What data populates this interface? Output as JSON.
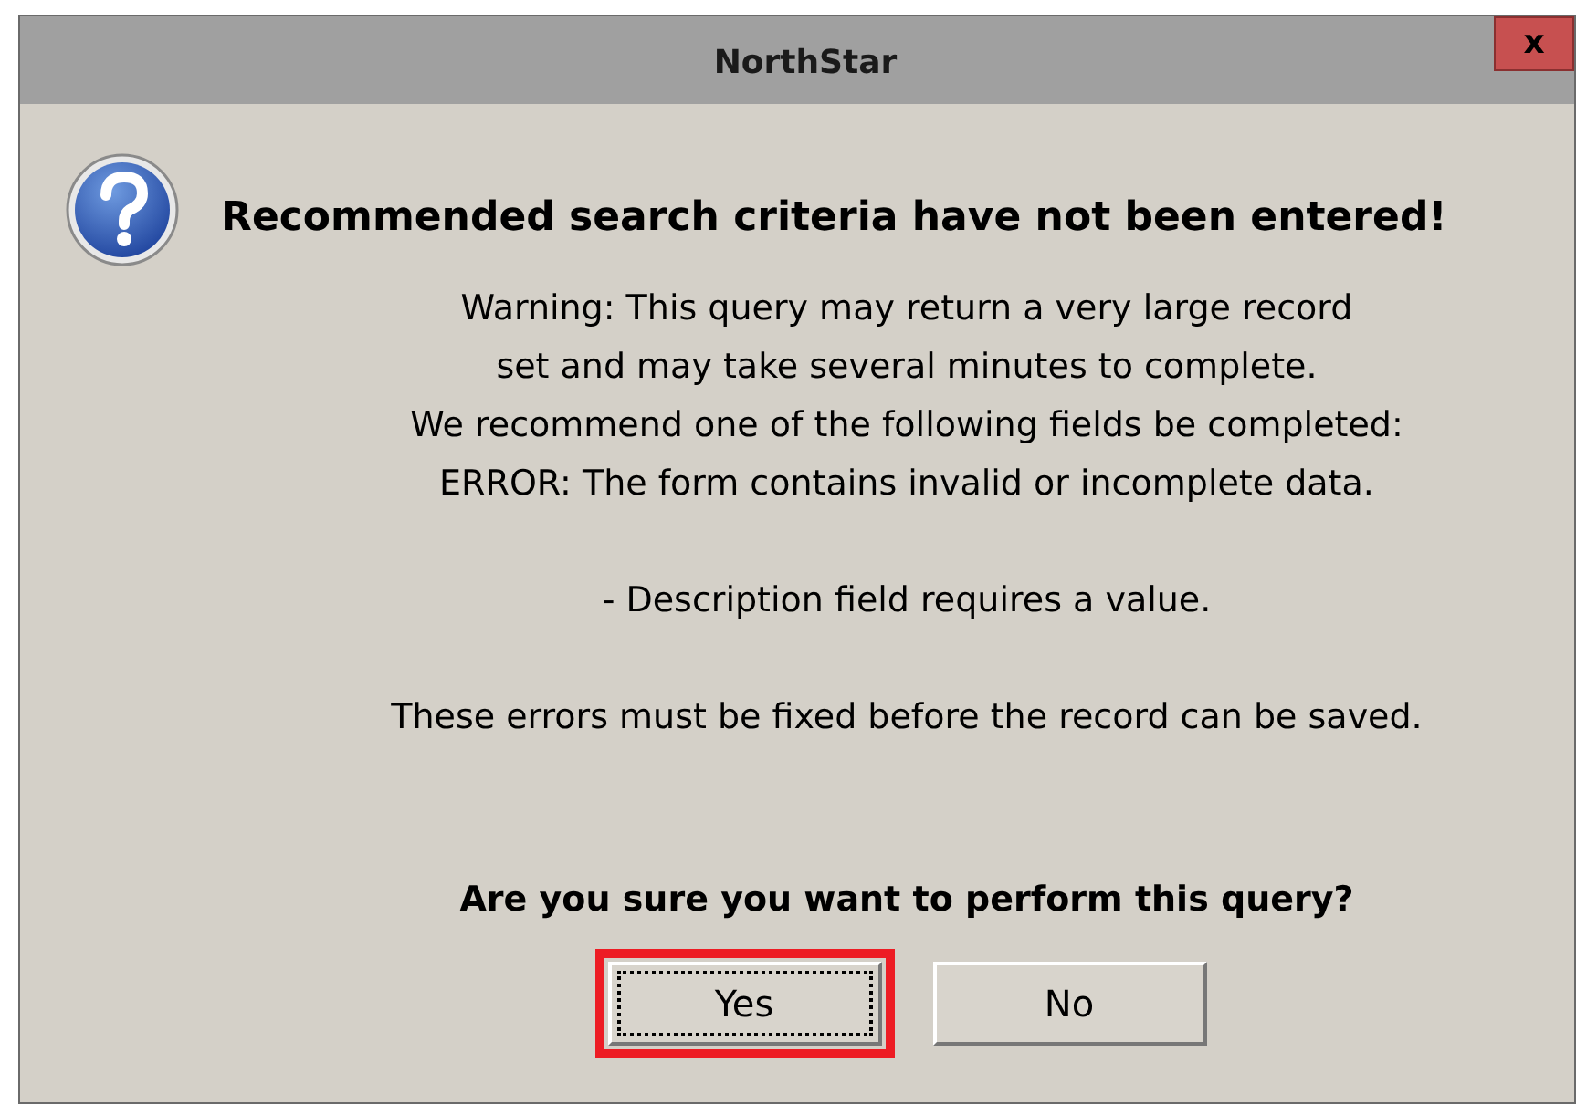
{
  "window": {
    "title": "NorthStar",
    "close_label": "x"
  },
  "heading": "Recommended search criteria have not been entered!",
  "message_paragraphs": [
    [
      "Warning: This query may return a very large record",
      "set and may take several minutes to complete.",
      "We recommend one of the following fields be completed:",
      "ERROR: The form contains invalid or incomplete data."
    ],
    [
      "- Description field requires a value."
    ],
    [
      "These errors must be fixed before the record can be saved."
    ]
  ],
  "question": "Are you sure you want to perform this query?",
  "buttons": [
    {
      "label": "Yes",
      "focused": true,
      "highlighted": true
    },
    {
      "label": "No",
      "focused": false,
      "highlighted": false
    }
  ]
}
